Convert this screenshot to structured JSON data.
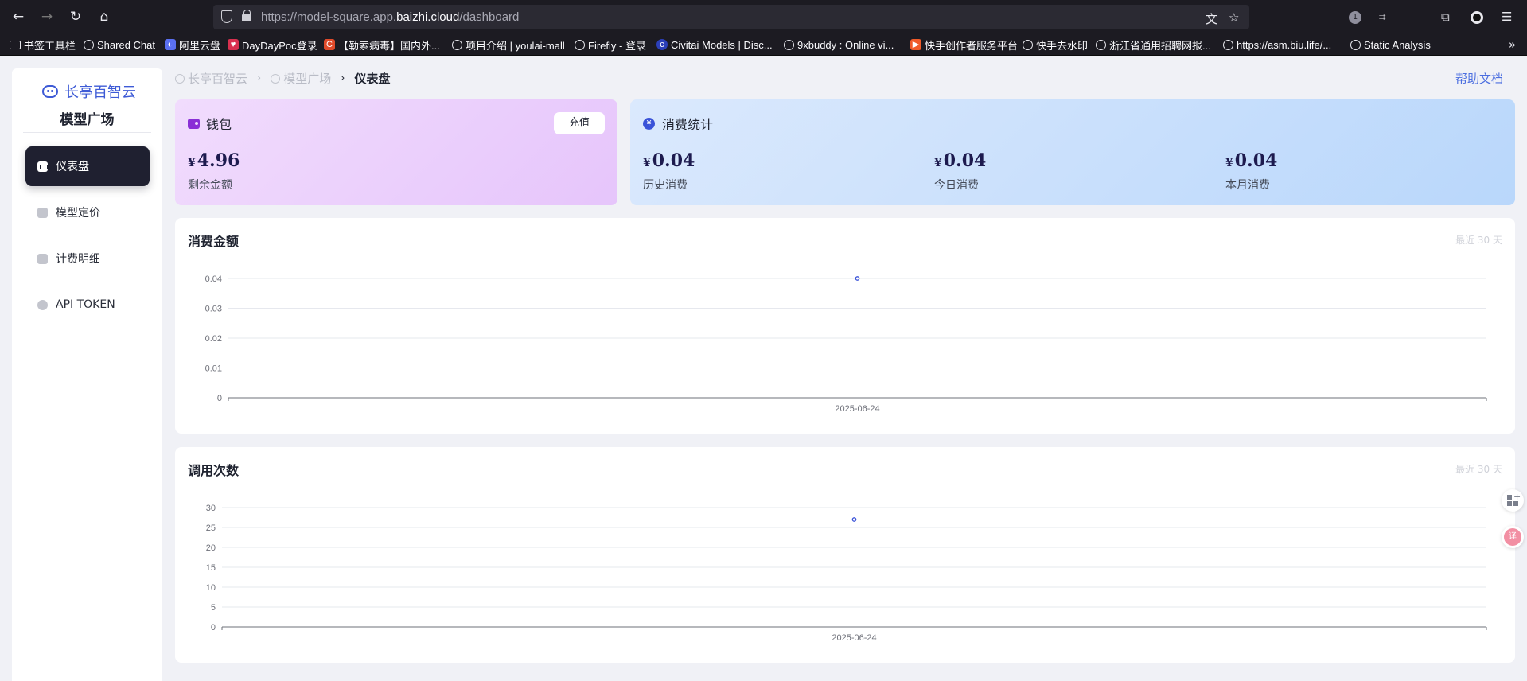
{
  "browser": {
    "url_prefix": "https://model-square.app.",
    "url_host": "baizhi.cloud",
    "url_path": "/dashboard",
    "extension_badge": "1",
    "bookmarks": [
      {
        "label": "书签工具栏",
        "icon": "folder-icon"
      },
      {
        "label": "Shared Chat",
        "icon": "globe-icon"
      },
      {
        "label": "阿里云盘",
        "icon": "aliyun-drive-icon"
      },
      {
        "label": "DayDayPoc登录",
        "icon": "daydaypoc-icon"
      },
      {
        "label": "【勒索病毒】国内外...",
        "icon": "c-logo-icon"
      },
      {
        "label": "项目介绍 | youlai-mall",
        "icon": "globe-icon"
      },
      {
        "label": "Firefly - 登录",
        "icon": "globe-icon"
      },
      {
        "label": "Civitai Models | Disc...",
        "icon": "civitai-icon"
      },
      {
        "label": "9xbuddy : Online vi...",
        "icon": "globe-icon"
      },
      {
        "label": "快手创作者服务平台",
        "icon": "kuaishou-icon"
      },
      {
        "label": "快手去水印",
        "icon": "globe-icon"
      },
      {
        "label": "浙江省通用招聘网报...",
        "icon": "globe-icon"
      },
      {
        "label": "https://asm.biu.life/...",
        "icon": "globe-icon"
      },
      {
        "label": "Static Analysis",
        "icon": "globe-icon"
      }
    ]
  },
  "sidebar": {
    "brand": "长亭百智云",
    "subtitle": "模型广场",
    "items": [
      {
        "label": "仪表盘",
        "icon": "chart-icon",
        "active": true
      },
      {
        "label": "模型定价",
        "icon": "cube-icon",
        "active": false
      },
      {
        "label": "计费明细",
        "icon": "doc-icon",
        "active": false
      },
      {
        "label": "API TOKEN",
        "icon": "key-icon",
        "active": false
      }
    ]
  },
  "breadcrumb": [
    "长亭百智云",
    "模型广场",
    "仪表盘"
  ],
  "help_link": "帮助文档",
  "wallet": {
    "title": "钱包",
    "button": "充值",
    "currency": "¥",
    "amount": "4.96",
    "label": "剩余金额"
  },
  "stats": {
    "title": "消费统计",
    "currency": "¥",
    "items": [
      {
        "value": "0.04",
        "label": "历史消费"
      },
      {
        "value": "0.04",
        "label": "今日消费"
      },
      {
        "value": "0.04",
        "label": "本月消费"
      }
    ]
  },
  "charts": {
    "amount_title": "消费金额",
    "calls_title": "调用次数",
    "range_note": "最近 30 天"
  },
  "colors": {
    "accent": "#3e5bd6",
    "point": "#3a52d8"
  },
  "chart_data": [
    {
      "type": "line",
      "title": "消费金额",
      "x": [
        "2025-06-24"
      ],
      "series": [
        {
          "values": [
            0.04
          ]
        }
      ],
      "yticks": [
        "0",
        "0.01",
        "0.02",
        "0.03",
        "0.04"
      ],
      "ylim": [
        0,
        0.04
      ],
      "grid": true
    },
    {
      "type": "line",
      "title": "调用次数",
      "x": [
        "2025-06-24"
      ],
      "series": [
        {
          "values": [
            27
          ]
        }
      ],
      "yticks": [
        "0",
        "5",
        "10",
        "15",
        "20",
        "25",
        "30"
      ],
      "ylim": [
        0,
        30
      ],
      "grid": true
    }
  ]
}
